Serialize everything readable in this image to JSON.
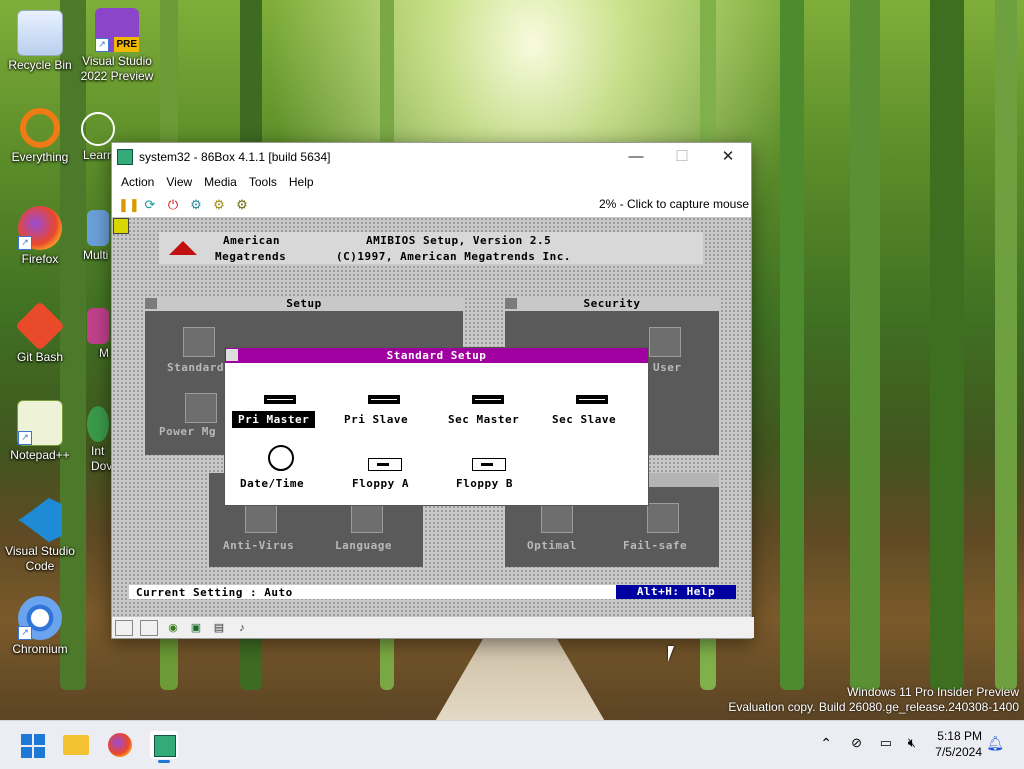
{
  "desktop": {
    "icons": [
      {
        "label": "Recycle Bin",
        "icon": "recycle-bin-icon"
      },
      {
        "label": "Visual Studio 2022 Preview",
        "icon": "visual-studio-icon",
        "badge": "PRE"
      },
      {
        "label": "Everything",
        "icon": "everything-search-icon"
      },
      {
        "label": "Learn about this picture",
        "visible_label": "Learn this",
        "icon": "learn-picture-icon"
      },
      {
        "label": "Firefox",
        "icon": "firefox-icon"
      },
      {
        "label": "Multi",
        "icon": "multi-app-icon"
      },
      {
        "label": "Git Bash",
        "icon": "git-bash-icon"
      },
      {
        "label": "M",
        "icon": "app-icon"
      },
      {
        "label": "Notepad++",
        "icon": "notepad-plus-plus-icon"
      },
      {
        "label": "Int Dov",
        "icon": "app-icon"
      },
      {
        "label": "Visual Studio Code",
        "icon": "vscode-icon"
      },
      {
        "label": "Chromium",
        "icon": "chromium-icon"
      }
    ],
    "watermark": {
      "line1": "Windows 11 Pro Insider Preview",
      "line2": "Evaluation copy. Build 26080.ge_release.240308-1400"
    }
  },
  "window": {
    "title": "system32 - 86Box 4.1.1 [build 5634]",
    "controls": {
      "minimize": "—",
      "maximize": "☐",
      "close": "✕"
    },
    "menu": [
      "Action",
      "View",
      "Media",
      "Tools",
      "Help"
    ],
    "toolbar": {
      "buttons": [
        "pause-icon",
        "reset-icon",
        "power-icon",
        "settings-icon",
        "settings-alt-icon",
        "cog-icon"
      ],
      "status": "2% - Click to capture mouse"
    },
    "statusbar_icons": [
      "floppy-icon",
      "floppy-icon",
      "cdrom-icon",
      "hdd-icon",
      "network-icon",
      "sound-icon"
    ]
  },
  "bios": {
    "banner": {
      "line1_left": "American",
      "line1_right": "AMIBIOS Setup, Version 2.5",
      "line2_left": "Megatrends",
      "line2_right": "(C)1997, American Megatrends Inc."
    },
    "panels": {
      "setup": {
        "title": "Setup",
        "items": [
          "Standard",
          "Power Mg"
        ]
      },
      "security": {
        "title": "Security",
        "items": [
          "User"
        ]
      },
      "utility": {
        "items": [
          "Anti-Virus",
          "Language"
        ]
      },
      "default": {
        "items": [
          "Optimal",
          "Fail-safe"
        ]
      }
    },
    "dialog": {
      "title": "Standard Setup",
      "options": [
        "Pri Master",
        "Pri Slave",
        "Sec Master",
        "Sec Slave",
        "Date/Time",
        "Floppy A",
        "Floppy B"
      ],
      "selected": "Pri Master"
    },
    "current_setting": "Current Setting : Auto",
    "help": "Alt+H: Help"
  },
  "taskbar": {
    "items": [
      "start-icon",
      "file-explorer-icon",
      "firefox-icon",
      "86box-icon"
    ],
    "tray": [
      "chevron-up-icon",
      "network-offline-icon",
      "display-icon",
      "volume-muted-icon"
    ],
    "time": "5:18 PM",
    "date": "7/5/2024"
  },
  "colors": {
    "dialog_header": "#a000a0",
    "help_bar": "#0000a0",
    "bios_background": "#c8c8c8"
  }
}
